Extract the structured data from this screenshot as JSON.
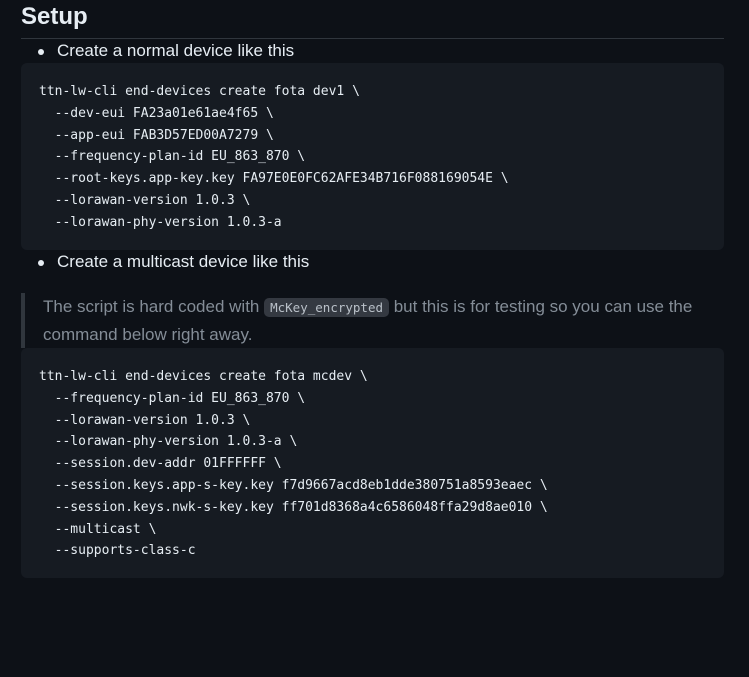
{
  "heading": "Setup",
  "bullet_1": "Create a normal device like this",
  "code_block_1": [
    "ttn-lw-cli end-devices create fota dev1 \\",
    "  --dev-eui FA23a01e61ae4f65 \\",
    "  --app-eui FAB3D57ED00A7279 \\",
    "  --frequency-plan-id EU_863_870 \\",
    "  --root-keys.app-key.key FA97E0E0FC62AFE34B716F088169054E \\",
    "  --lorawan-version 1.0.3 \\",
    "  --lorawan-phy-version 1.0.3-a"
  ],
  "bullet_2": "Create a multicast device like this",
  "note": {
    "before": "The script is hard coded with ",
    "code": "McKey_encrypted",
    "after": " but this is for testing so you can use the command below right away."
  },
  "code_block_2": [
    "ttn-lw-cli end-devices create fota mcdev \\",
    "  --frequency-plan-id EU_863_870 \\",
    "  --lorawan-version 1.0.3 \\",
    "  --lorawan-phy-version 1.0.3-a \\",
    "  --session.dev-addr 01FFFFFF \\",
    "  --session.keys.app-s-key.key f7d9667acd8eb1dde380751a8593eaec \\",
    "  --session.keys.nwk-s-key.key ff701d8368a4c6586048ffa29d8ae010 \\",
    "  --multicast \\",
    "  --supports-class-c"
  ]
}
